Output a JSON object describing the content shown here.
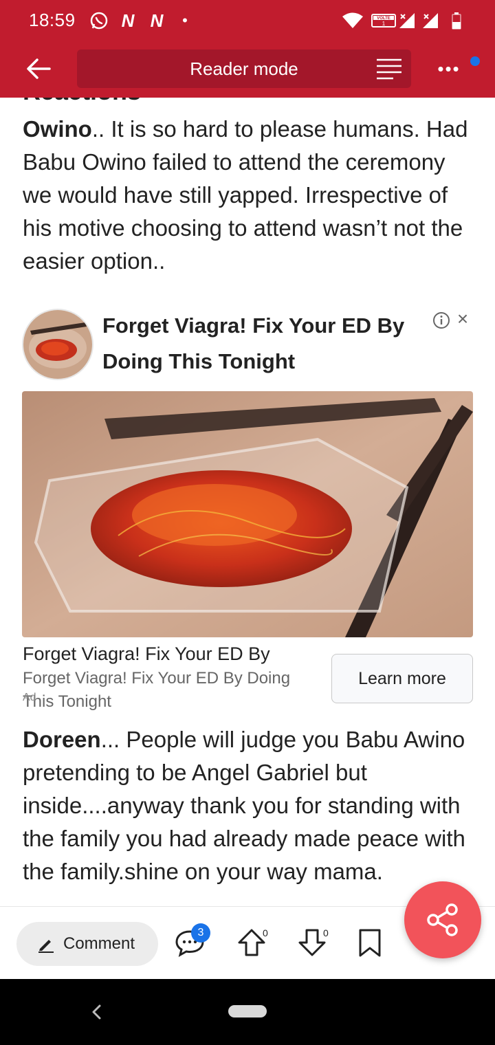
{
  "status_bar": {
    "time": "18:59",
    "icons": [
      "whatsapp-icon",
      "news-n-icon",
      "news-n-icon",
      "dot-icon",
      "wifi-icon",
      "volte-icon",
      "signal-icon",
      "signal-icon",
      "battery-icon"
    ],
    "volte_text": "VOLTE"
  },
  "app_bar": {
    "back_icon": "arrow-left-icon",
    "title": "Reader mode",
    "reader_icon": "text-lines-icon",
    "more_icon": "more-dots-icon",
    "more_text": "•••",
    "accent": "#c11c2e"
  },
  "article": {
    "cut_heading": "Reactions",
    "para1_name": "Owino",
    "para1_text": ".. It is so hard to please humans. Had Babu Owino failed to attend the ceremony we would have still yapped. Irrespective of his motive choosing to attend wasn’t not the easier option..",
    "para2_name": "Doreen",
    "para2_text": "... People will judge you Babu Awino pretending to be Angel Gabriel but inside....anyway thank you for standing with the family you had already made peace with the family.shine on your way mama."
  },
  "ad": {
    "title": "Forget Viagra! Fix Your ED By Doing This Tonight",
    "info_icon": "info-circle-icon",
    "close_text": "×",
    "headline": "Forget Viagra! Fix Your ED By",
    "description": "Forget Viagra! Fix Your ED By Doing This Tonight",
    "ad_label": "Ad",
    "cta": "Learn more"
  },
  "toolbar": {
    "comment_label": "Comment",
    "comment_count": "3",
    "upvote_count": "0",
    "downvote_count": "0",
    "share_color": "#f2535a"
  }
}
